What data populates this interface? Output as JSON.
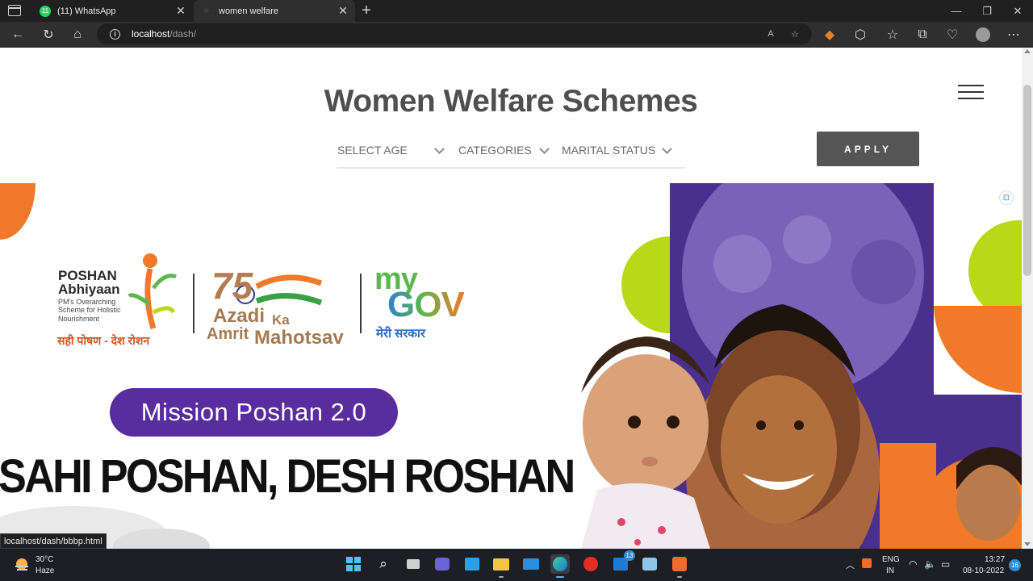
{
  "browser": {
    "tabs": [
      {
        "label": "(11) WhatsApp",
        "favicon": "whatsapp-icon",
        "favicon_text": "11"
      },
      {
        "label": "women welfare",
        "favicon": "page-icon"
      }
    ],
    "url_host": "localhost",
    "url_path": "/dash/",
    "status_url": "localhost/dash/bbbp.html"
  },
  "page": {
    "title": "Women Welfare Schemes",
    "filters": {
      "age": "SELECT AGE",
      "categories": "CATEGORIES",
      "marital": "MARITAL STATUS"
    },
    "apply_label": "APPLY"
  },
  "banner": {
    "poshan_title_1": "POSHAN",
    "poshan_title_2": "Abhiyaan",
    "poshan_sub_1": "PM's Overarching",
    "poshan_sub_2": "Scheme for Holistic",
    "poshan_sub_3": "Nourishment",
    "poshan_hindi": "सही पोषण - देश रोशन",
    "azadi_75": "75",
    "azadi_1": "Azadi",
    "azadi_ka": "Ka",
    "azadi_2": "Amrit",
    "azadi_3": "Mahotsav",
    "mygov_my": "my",
    "mygov_gov": "GOV",
    "mygov_hindi": "मेरी सरकार",
    "mission": "Mission Poshan 2.0",
    "slogan": "SAHI POSHAN, DESH ROSHAN"
  },
  "taskbar": {
    "temperature": "30°C",
    "condition": "Haze",
    "language_1": "ENG",
    "language_2": "IN",
    "time": "13:27",
    "date": "08-10-2022",
    "notifications": "16",
    "teams_badge": "13"
  },
  "colors": {
    "page_bg": "#ffffff",
    "title": "#4f4f4f",
    "apply_bg": "#555555",
    "mission_purple": "#5a2d9e",
    "orange": "#f07a2a",
    "lime": "#b9d81a",
    "photo_purple": "#5b3f9a"
  }
}
